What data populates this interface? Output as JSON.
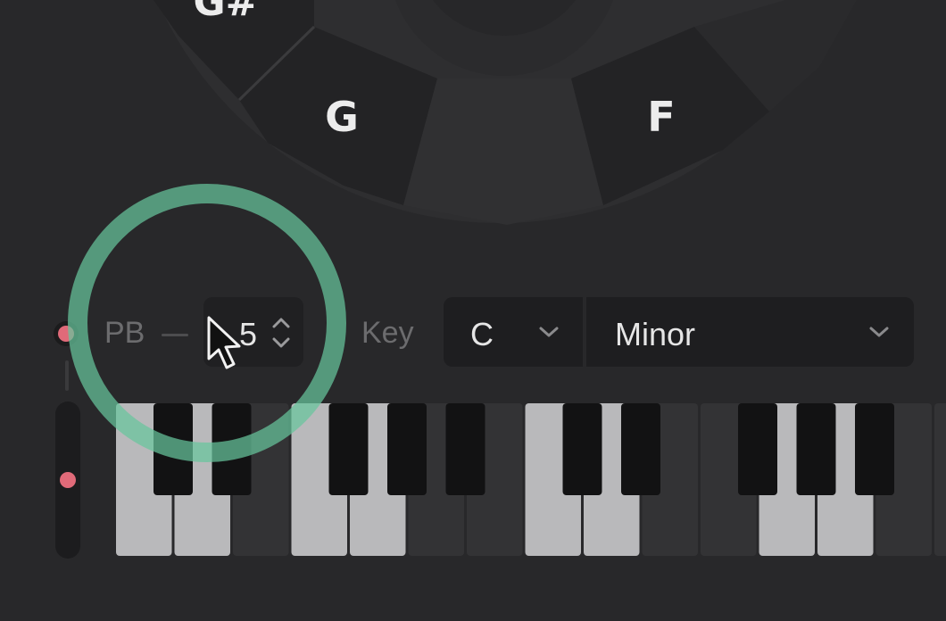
{
  "key_wheel": {
    "labels": {
      "g_sharp": "G#",
      "g": "G",
      "f": "F"
    }
  },
  "pitch_bend": {
    "label": "PB",
    "range_value": "5"
  },
  "key_selector": {
    "label": "Key",
    "root": "C",
    "scale": "Minor"
  },
  "keyboard": {
    "white_keys_lit": [
      true,
      true,
      false,
      true,
      true,
      false,
      false,
      true,
      true,
      false,
      false,
      true,
      true,
      false,
      false,
      false
    ],
    "black_keys_lit": [
      false,
      false,
      false,
      false,
      false,
      false,
      false,
      false,
      false,
      false,
      false
    ]
  },
  "colors": {
    "background": "#28282a",
    "accent_green": "#66c59c",
    "record_red": "#e06a79",
    "lit_white_key": "#b9b9bb",
    "unlit_white_key": "#333335",
    "black_key": "#121213"
  }
}
